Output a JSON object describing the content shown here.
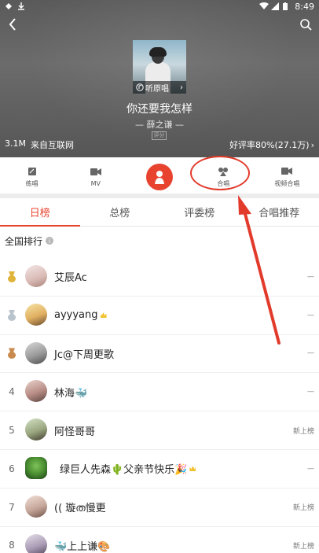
{
  "status_bar": {
    "time": "8:49"
  },
  "song": {
    "title": "你还要我怎样",
    "artist": "— 薛之谦 —",
    "rating_tag": "评分",
    "listen_original_label": "听原唱",
    "plays": "3.1M",
    "source": "来自互联网",
    "good_rate": "好评率80%(27.1万)"
  },
  "actions": [
    {
      "label": "练唱",
      "icon": "practice-icon"
    },
    {
      "label": "MV",
      "icon": "video-icon"
    },
    {
      "label": "",
      "icon": "sing-icon"
    },
    {
      "label": "合唱",
      "icon": "duet-icon"
    },
    {
      "label": "视频合唱",
      "icon": "video-duet-icon"
    }
  ],
  "tabs": [
    {
      "label": "日榜",
      "active": true
    },
    {
      "label": "总榜",
      "active": false
    },
    {
      "label": "评委榜",
      "active": false
    },
    {
      "label": "合唱推荐",
      "active": false
    }
  ],
  "section_title": "全国排行",
  "ranking": [
    {
      "rank": "",
      "medal": "gold",
      "name": "艾辰Ac",
      "trend": "—",
      "vip": false,
      "emoji": ""
    },
    {
      "rank": "",
      "medal": "silver",
      "name": "ayyyang",
      "trend": "—",
      "vip": true,
      "emoji": ""
    },
    {
      "rank": "",
      "medal": "bronze",
      "name": "Jc@下周更歌",
      "trend": "—",
      "vip": false,
      "emoji": ""
    },
    {
      "rank": "4",
      "medal": "",
      "name": "林海🐳",
      "trend": "—",
      "vip": false,
      "emoji": ""
    },
    {
      "rank": "5",
      "medal": "",
      "name": "阿怪哥哥",
      "trend": "新上榜",
      "vip": false,
      "emoji": ""
    },
    {
      "rank": "6",
      "medal": "",
      "name": "绿巨人先森🌵父亲节快乐🎉",
      "trend": "—",
      "vip": true,
      "emoji": ""
    },
    {
      "rank": "7",
      "medal": "",
      "name": "(( 璇ത慢更",
      "trend": "新上榜",
      "vip": false,
      "emoji": ""
    },
    {
      "rank": "8",
      "medal": "",
      "name": "🐳上上谦🎨",
      "trend": "新上榜",
      "vip": false,
      "emoji": ""
    }
  ],
  "colors": {
    "accent": "#e8432f",
    "gold": "#e0b33a",
    "silver": "#b9c3cc",
    "bronze": "#c88a4d"
  }
}
